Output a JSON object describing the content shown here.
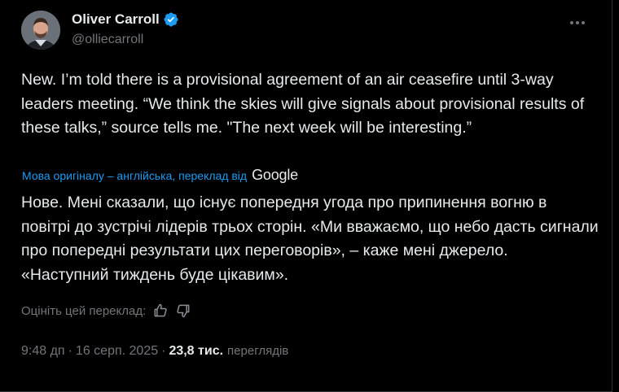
{
  "author": {
    "display_name": "Oliver Carroll",
    "handle": "@olliecarroll",
    "verified": true,
    "badge_color": "#1d9bf0"
  },
  "tweet": {
    "text": "New. I’m told there is a provisional agreement of an air ceasefire until 3-way leaders meeting. “We think the skies will give signals about provisional results of these talks,” source tells me. \"The next week will be interesting.”"
  },
  "translation": {
    "note": "Мова оригіналу – англійська, переклад від",
    "provider": "Google",
    "text": "Нове. Мені сказали, що існує попередня угода про припинення вогню в повітрі до зустрічі лідерів трьох сторін. «Ми вважаємо, що небо дасть сигнали про попередні результати цих переговорів», – каже мені джерело. «Наступний тиждень буде цікавим».",
    "rate_label": "Оцініть цей переклад:"
  },
  "meta": {
    "time": "9:48 дп",
    "date": "16 серп. 2025",
    "separator": "·",
    "views_count": "23,8 тис.",
    "views_label": "переглядів"
  },
  "colors": {
    "background": "#000000",
    "text": "#e7e9ea",
    "muted": "#71767b",
    "link": "#1d9bf0",
    "border": "#2f3336"
  },
  "icons": {
    "more": "more-options-icon",
    "verified": "verified-badge-icon",
    "thumbs_up": "thumbs-up-icon",
    "thumbs_down": "thumbs-down-icon"
  }
}
